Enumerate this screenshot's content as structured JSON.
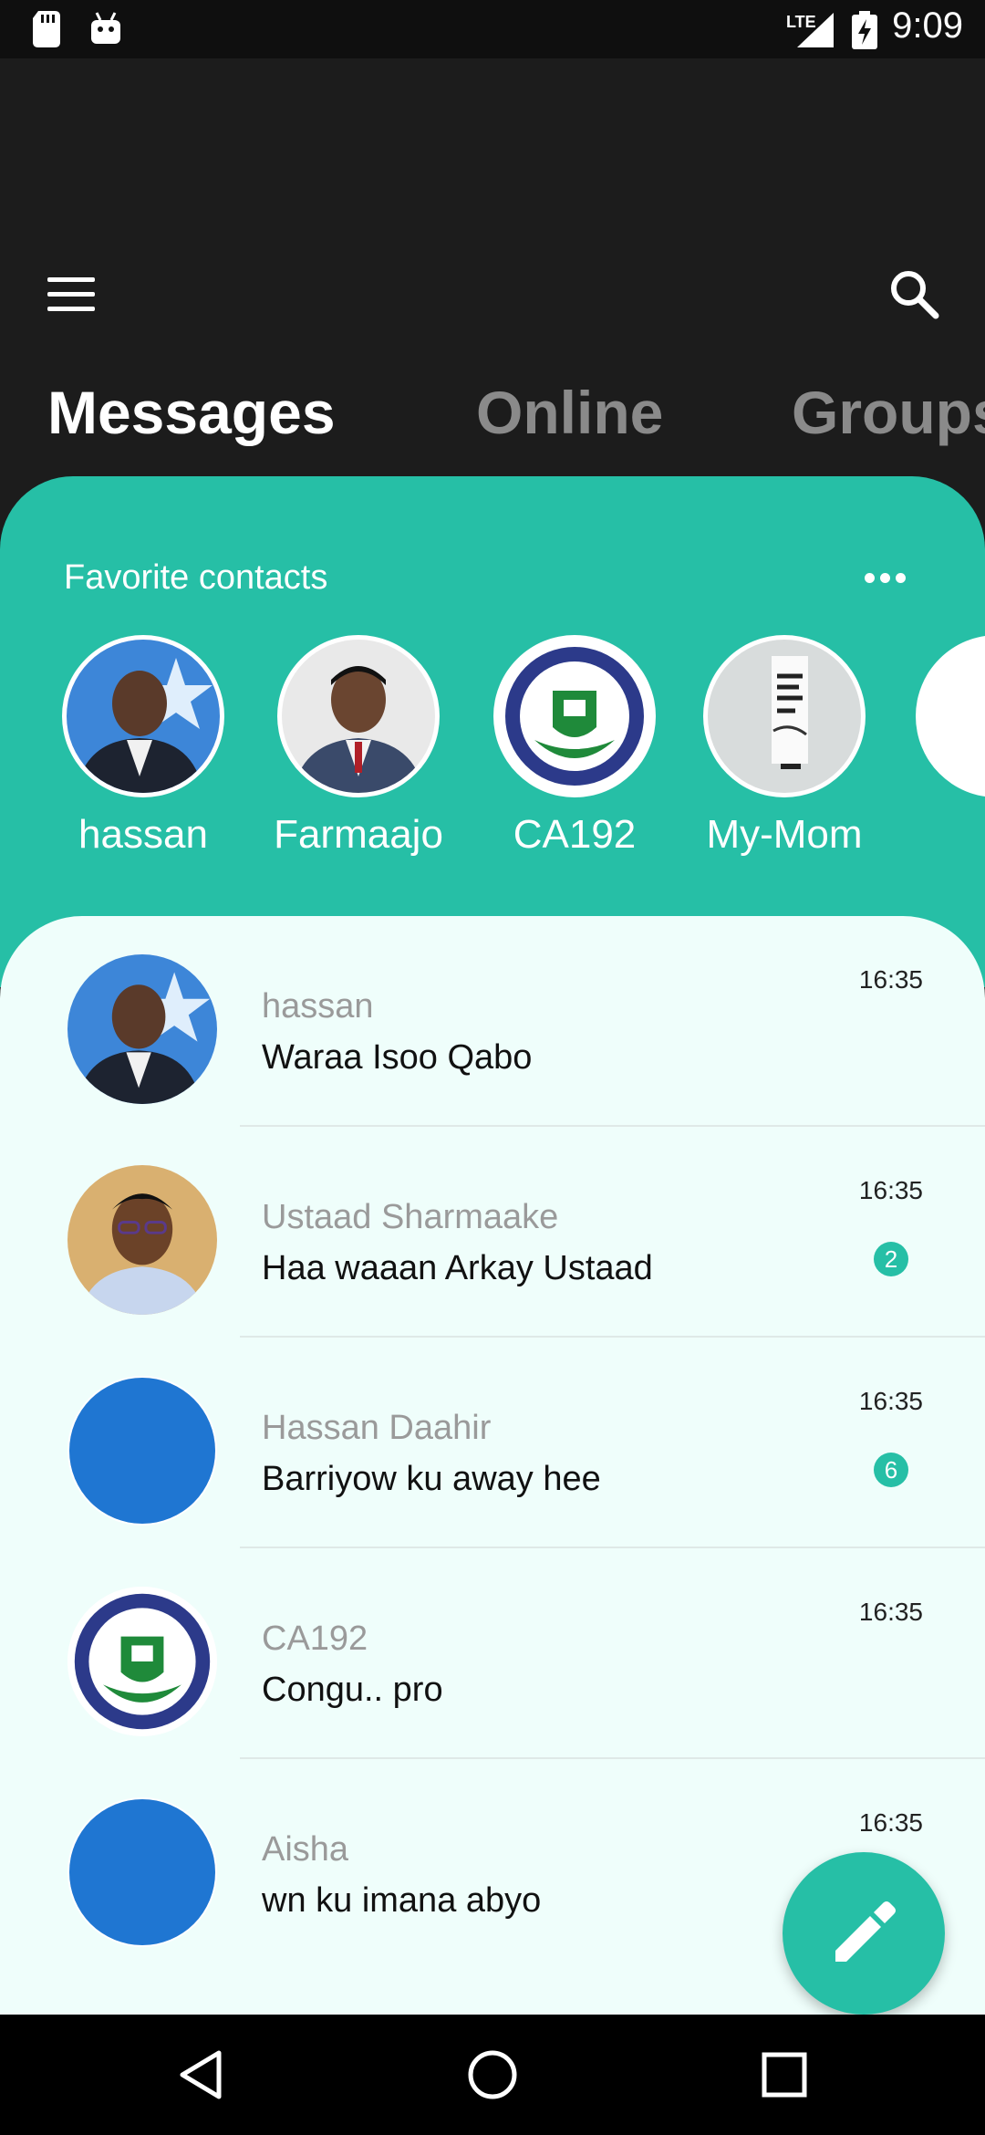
{
  "status_bar": {
    "time": "9:09",
    "network": "LTE",
    "icons": [
      "sd-card-icon",
      "android-icon",
      "signal-icon",
      "battery-charging-icon"
    ]
  },
  "app_bar": {
    "menu_icon": "hamburger-menu-icon",
    "search_icon": "search-icon",
    "tabs": [
      {
        "label": "Messages",
        "active": true
      },
      {
        "label": "Online",
        "active": false
      },
      {
        "label": "Groups",
        "active": false
      }
    ]
  },
  "favorites": {
    "title": "Favorite contacts",
    "more_icon": "more-horizontal-icon",
    "items": [
      {
        "name": "hassan"
      },
      {
        "name": "Farmaajo"
      },
      {
        "name": "CA192"
      },
      {
        "name": "My-Mom"
      }
    ]
  },
  "chats": [
    {
      "name": "hassan",
      "message": "Waraa Isoo Qabo",
      "time": "16:35",
      "unread": null
    },
    {
      "name": "Ustaad Sharmaake",
      "message": "Haa waaan Arkay Ustaad",
      "time": "16:35",
      "unread": "2"
    },
    {
      "name": "Hassan Daahir",
      "message": "Barriyow ku away hee",
      "time": "16:35",
      "unread": "6"
    },
    {
      "name": "CA192",
      "message": "Congu.. pro",
      "time": "16:35",
      "unread": null
    },
    {
      "name": "Aisha",
      "message": "wn ku imana abyo",
      "time": "16:35",
      "unread": null
    }
  ],
  "fab": {
    "icon": "edit-pencil-icon"
  },
  "colors": {
    "accent": "#26bfa6",
    "background_dark": "#1c1c1c",
    "chat_background": "#effefb",
    "default_avatar": "#1f76d2"
  },
  "nav_bar": {
    "icons": [
      "back-triangle-icon",
      "home-circle-icon",
      "recents-square-icon"
    ]
  }
}
